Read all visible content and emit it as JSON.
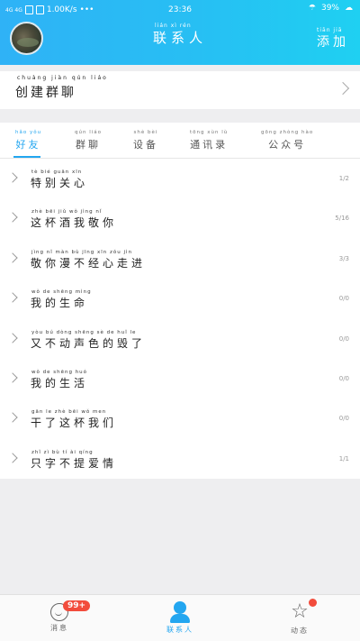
{
  "status_bar": {
    "network": "4G 4G",
    "speed": "1.00K/s",
    "dots": "•••",
    "time": "23:36",
    "battery": "39%"
  },
  "header": {
    "title": "联系人",
    "title_pinyin": "lián xì rén",
    "add_label": "添加",
    "add_pinyin": "tiān jiā"
  },
  "create_group": {
    "label": "创建群聊",
    "pinyin": "chuàng jiàn qún liáo"
  },
  "tabs": [
    {
      "label": "好友",
      "pinyin": "hǎo yǒu",
      "active": true
    },
    {
      "label": "群聊",
      "pinyin": "qún liáo",
      "active": false
    },
    {
      "label": "设备",
      "pinyin": "shè bèi",
      "active": false
    },
    {
      "label": "通讯录",
      "pinyin": "tōng xùn lù",
      "active": false
    },
    {
      "label": "公众号",
      "pinyin": "gōng zhòng hào",
      "active": false
    }
  ],
  "groups": [
    {
      "name": "特别关心",
      "pinyin": "tè bié guān xīn",
      "count": "1/2"
    },
    {
      "name": "这杯酒我敬你",
      "pinyin": "zhè bēi jiǔ wǒ jìng nǐ",
      "count": "5/16"
    },
    {
      "name": "敬你漫不经心走进",
      "pinyin": "jìng nǐ màn bù jīng xīn zǒu jìn",
      "count": "3/3"
    },
    {
      "name": "我的生命",
      "pinyin": "wǒ de shēng mìng",
      "count": "0/0"
    },
    {
      "name": "又不动声色的毁了",
      "pinyin": "yòu bú dòng shēng sè de huǐ le",
      "count": "0/0"
    },
    {
      "name": "我的生活",
      "pinyin": "wǒ de shēng huó",
      "count": "0/0"
    },
    {
      "name": "干了这杯我们",
      "pinyin": "gān le zhè bēi wǒ men",
      "count": "0/0"
    },
    {
      "name": "只字不提爱情",
      "pinyin": "zhǐ zì bù tí ài qíng",
      "count": "1/1"
    }
  ],
  "bottom_nav": [
    {
      "label": "消息",
      "badge": "99+",
      "active": false
    },
    {
      "label": "联系人",
      "active": true
    },
    {
      "label": "动态",
      "active": false
    }
  ],
  "colors": {
    "accent": "#23a6f0",
    "badge": "#f24c3c"
  }
}
